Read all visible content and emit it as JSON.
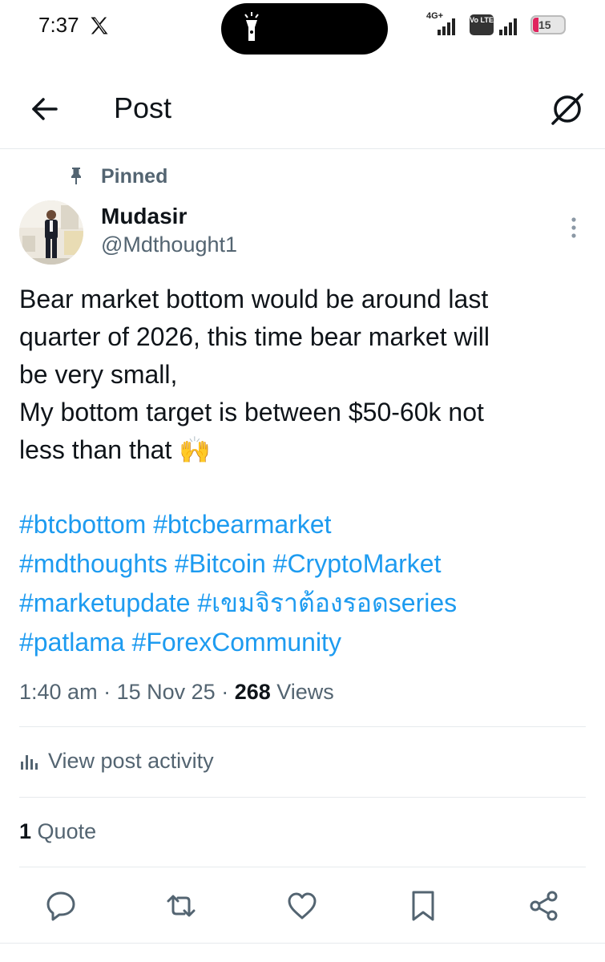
{
  "status_bar": {
    "time": "7:37",
    "network_label": "4G+",
    "volte_label": "Vo LTE",
    "battery": "15"
  },
  "header": {
    "title": "Post"
  },
  "pinned": {
    "label": "Pinned"
  },
  "author": {
    "name": "Mudasir",
    "handle": "@Mdthought1"
  },
  "post": {
    "lines": [
      "Bear market bottom would be around last",
      "quarter of 2026, this time bear market will",
      "be very small,",
      "My bottom target is between $50-60k not",
      "less than that 🙌"
    ],
    "hashtags": [
      [
        "#btcbottom",
        "#btcbearmarket"
      ],
      [
        "#mdthoughts",
        "#Bitcoin",
        "#CryptoMarket"
      ],
      [
        "#marketupdate",
        "#เขมจิราต้องรอดseries"
      ],
      [
        "#patlama",
        "#ForexCommunity"
      ]
    ]
  },
  "meta": {
    "time": "1:40 am",
    "date": "15 Nov 25",
    "views_count": "268",
    "views_label": "Views"
  },
  "activity": {
    "label": "View post activity"
  },
  "quotes": {
    "count": "1",
    "label": "Quote"
  },
  "actions": {
    "icons": [
      "reply-icon",
      "repost-icon",
      "like-icon",
      "bookmark-icon",
      "share-icon"
    ]
  },
  "colors": {
    "link": "#1d9bf0",
    "secondary_text": "#536471",
    "primary_text": "#0f1419"
  }
}
